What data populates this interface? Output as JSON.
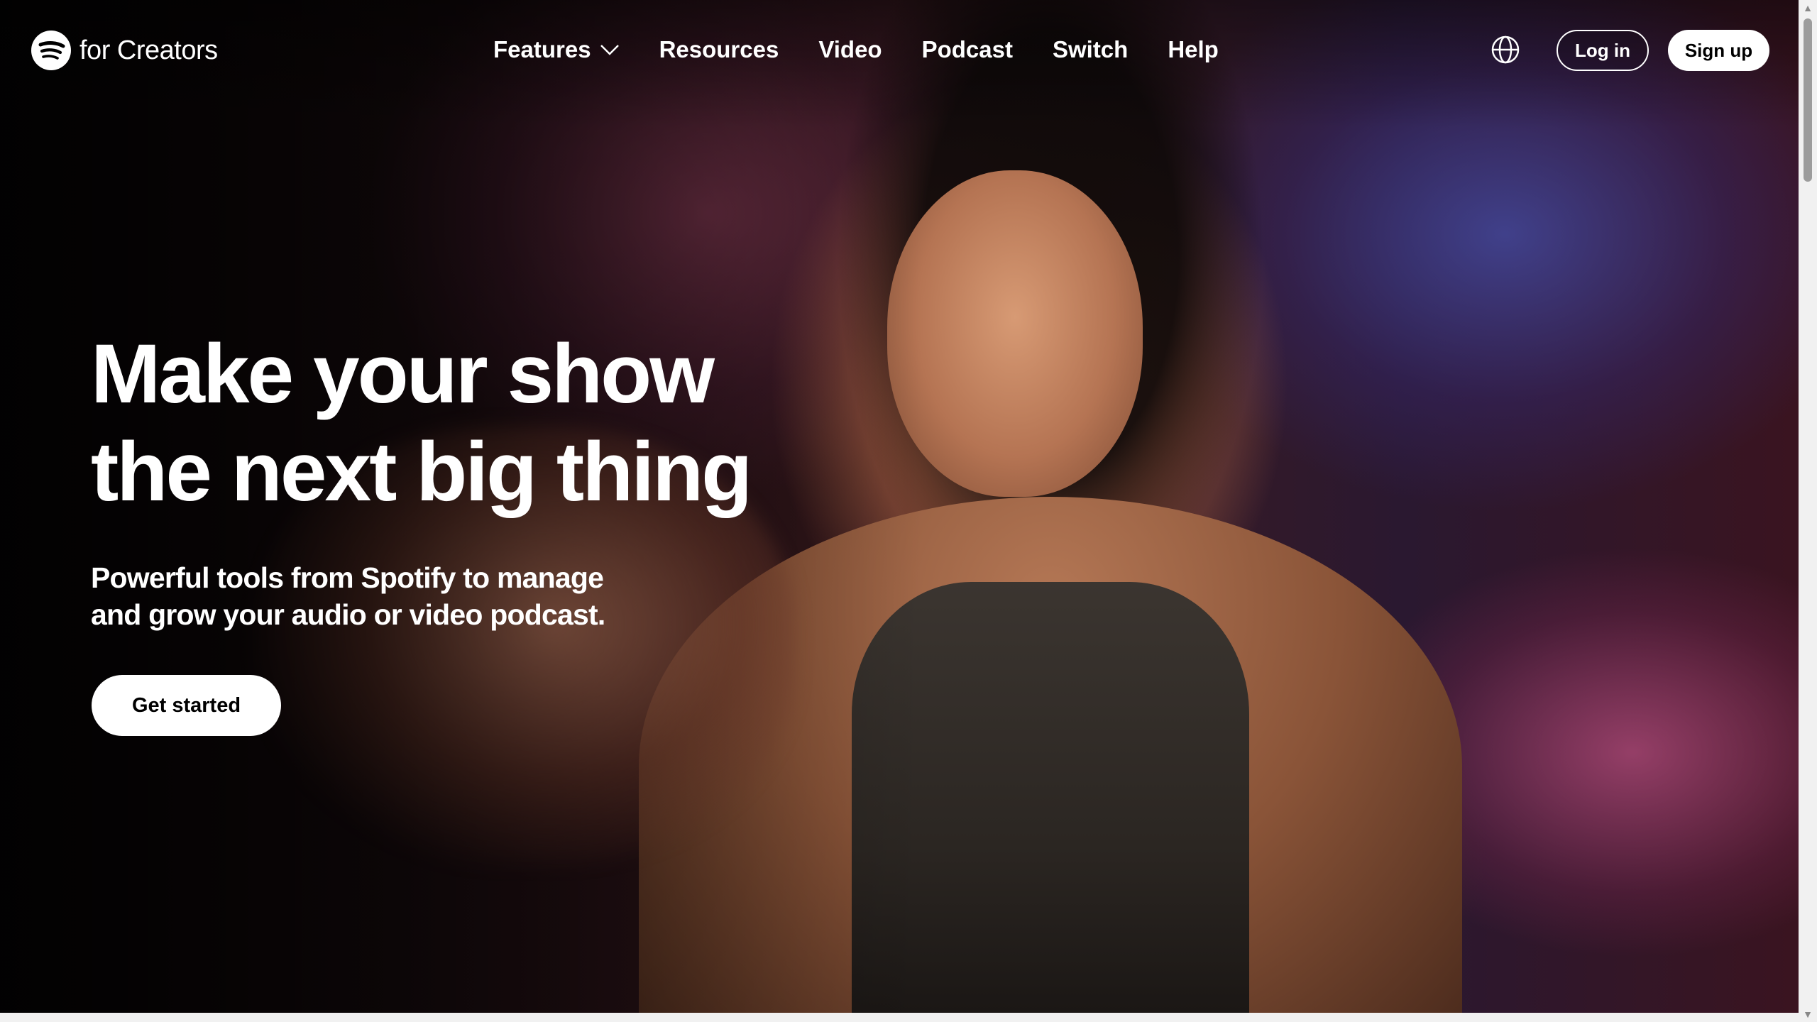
{
  "header": {
    "logo_text": "for Creators",
    "nav": [
      {
        "label": "Features",
        "has_dropdown": true
      },
      {
        "label": "Resources"
      },
      {
        "label": "Video"
      },
      {
        "label": "Podcast"
      },
      {
        "label": "Switch"
      },
      {
        "label": "Help"
      }
    ],
    "language_icon": "globe-icon",
    "login_label": "Log in",
    "signup_label": "Sign up"
  },
  "hero": {
    "title_line1": "Make your show",
    "title_line2": "the next big thing",
    "subtitle_line1": "Powerful tools from Spotify to manage",
    "subtitle_line2": "and grow your audio or video podcast.",
    "cta_label": "Get started"
  },
  "colors": {
    "text": "#ffffff",
    "button_bg": "#ffffff",
    "button_text": "#000000"
  }
}
